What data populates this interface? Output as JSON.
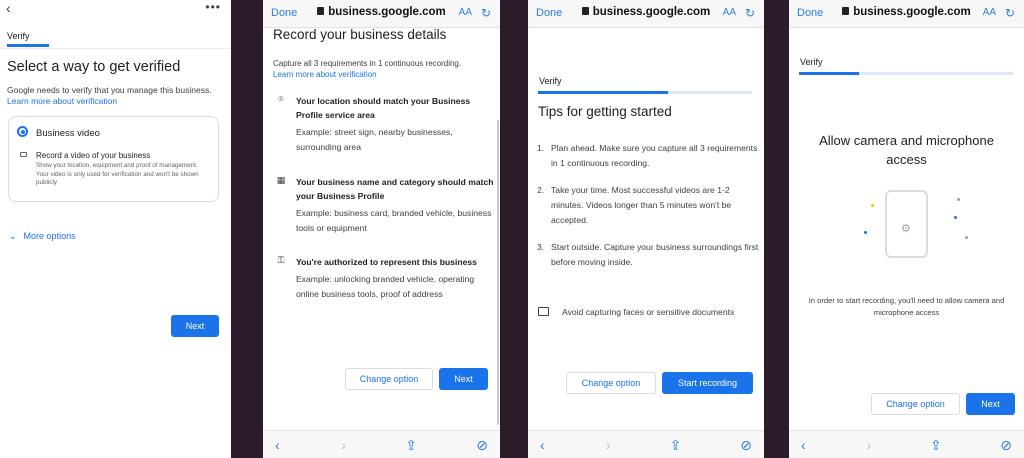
{
  "panel1": {
    "header_tab": "Verify",
    "title": "Select a way to get verified",
    "description": "Google needs to verify that you manage this business.",
    "learn_more": "Learn more about verification",
    "option_title": "Business video",
    "option_heading": "Record a video of your business",
    "option_body": "Show your location, equipment and proof of management. Your video is only used for verification and won't be shown publicly",
    "more_options": "More options",
    "next_label": "Next"
  },
  "browser": {
    "done": "Done",
    "url": "business.google.com",
    "text_size": "AA"
  },
  "panel2": {
    "title": "Record your business details",
    "subtitle": "Capture all 3 requirements in 1 continuous recording.",
    "learn_more": "Learn more about verification",
    "requirements": [
      {
        "icon": "location-pin-icon",
        "title": "Your location should match your Business Profile service area",
        "example": "Example: street sign, nearby businesses, surrounding area"
      },
      {
        "icon": "storefront-icon",
        "title": "Your business name and category should match your Business Profile",
        "example": "Example: business card, branded vehicle, business tools or equipment"
      },
      {
        "icon": "key-icon",
        "title": "You're authorized to represent this business",
        "example": "Example: unlocking branded vehicle, operating online business tools, proof of address"
      }
    ],
    "change_option": "Change option",
    "next_label": "Next"
  },
  "panel3": {
    "header_tab": "Verify",
    "title": "Tips for getting started",
    "tips": [
      {
        "num": "1.",
        "text": "Plan ahead. Make sure you capture all 3 requirements in 1 continuous recording."
      },
      {
        "num": "2.",
        "text": "Take your time. Most successful videos are 1-2 minutes. Videos longer than 5 minutes won't be accepted."
      },
      {
        "num": "3.",
        "text": "Start outside. Capture your business surroundings first before moving inside."
      }
    ],
    "avoid": "Avoid capturing faces or sensitive documents",
    "change_option": "Change option",
    "start_recording": "Start recording"
  },
  "panel4": {
    "header_tab": "Verify",
    "title": "Allow camera and microphone access",
    "body": "In order to start recording, you'll need to allow camera and microphone access",
    "change_option": "Change option",
    "next_label": "Next"
  },
  "colors": {
    "accent": "#1a73e8",
    "safari_blue": "#2a7de1",
    "progress_track": "#dbe7fb"
  }
}
